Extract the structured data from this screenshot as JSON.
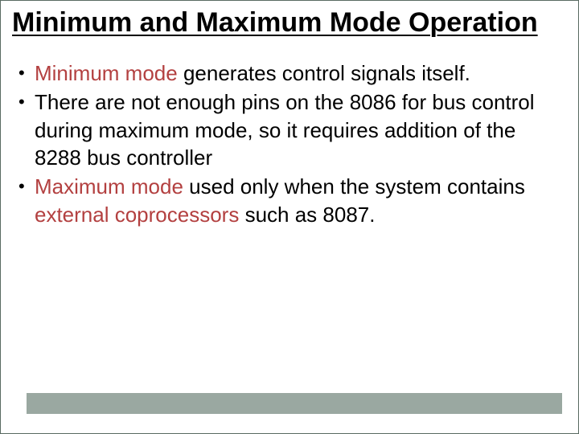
{
  "title": "Minimum and Maximum Mode Operation",
  "bullets": [
    {
      "pre": " ",
      "hl1": "Minimum mode",
      "mid1": " generates control signals itself."
    },
    {
      "pre": "There are not enough pins on the 8086 for bus control during maximum mode, so it requires addition of the 8288 bus controller"
    },
    {
      "hl1": "Maximum mode",
      "mid1": " used only when the system contains ",
      "hl2": "external coprocessors",
      "mid2": " such as 8087."
    }
  ]
}
